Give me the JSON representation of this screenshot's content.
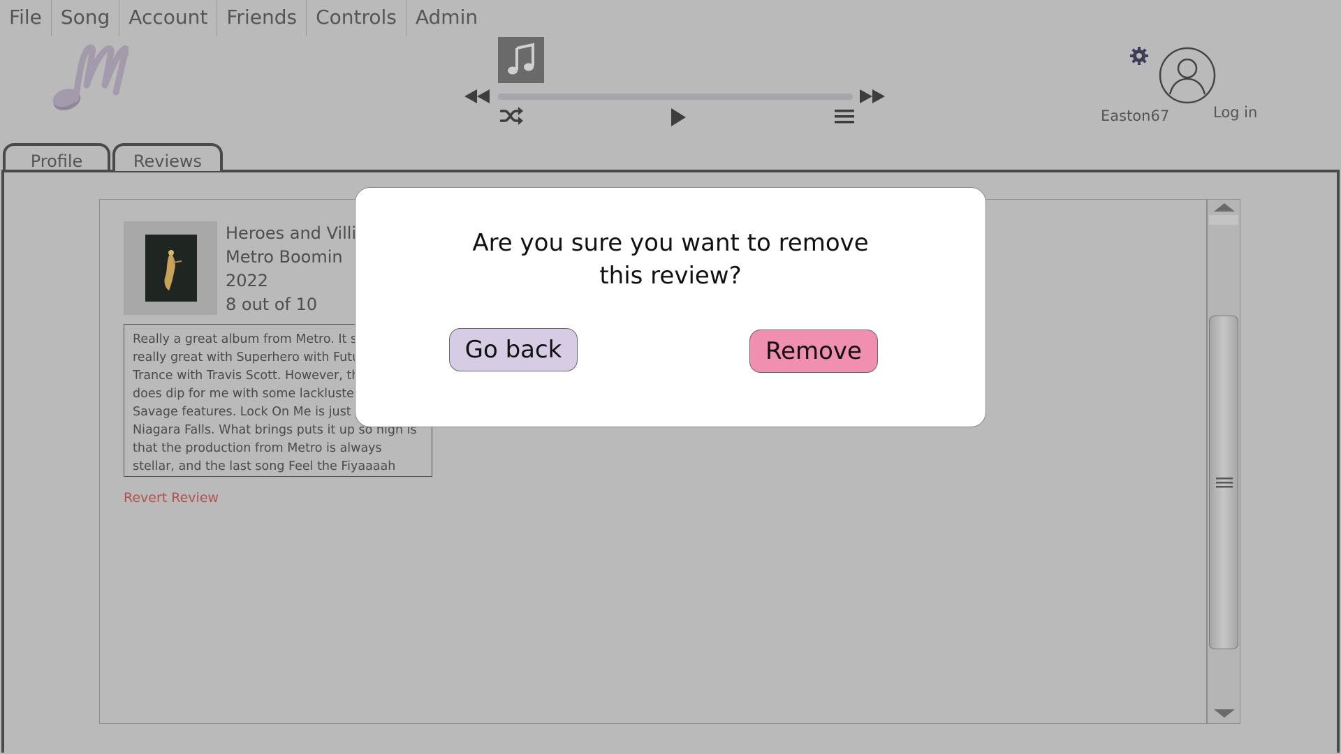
{
  "menu": [
    "File",
    "Song",
    "Account",
    "Friends",
    "Controls",
    "Admin"
  ],
  "colors": {
    "accent_purple": "#d6cce4",
    "danger_pink": "#f08fb0",
    "logo": "#a39aab"
  },
  "player": {
    "progress": 0,
    "icons": [
      "music-note-icon",
      "rewind-icon",
      "fast-forward-icon",
      "shuffle-icon",
      "play-icon",
      "queue-icon"
    ]
  },
  "user": {
    "username": "Easton67",
    "login_label": "Log in"
  },
  "tabs": [
    {
      "label": "Profile",
      "active": false
    },
    {
      "label": "Reviews",
      "active": true
    }
  ],
  "review": {
    "album": "Heroes and Villians",
    "artist": "Metro Boomin",
    "year": "2022",
    "rating": "8 out of 10",
    "text": "Really a great album from Metro. It starts off really great with Superhero with Future and Trance with Travis Scott. However, the album does dip for me with some lackluster 21 Savage features. Lock On Me is just a weaker Niagara Falls. What brings puts it up so high is that the production from Metro is always stellar, and the last song Feel the Fiyaaaah with Takeoff and",
    "revert_label": "Revert Review"
  },
  "dialog": {
    "line1": "Are you sure you want to remove",
    "line2": "this review?",
    "back_label": "Go back",
    "remove_label": "Remove"
  }
}
